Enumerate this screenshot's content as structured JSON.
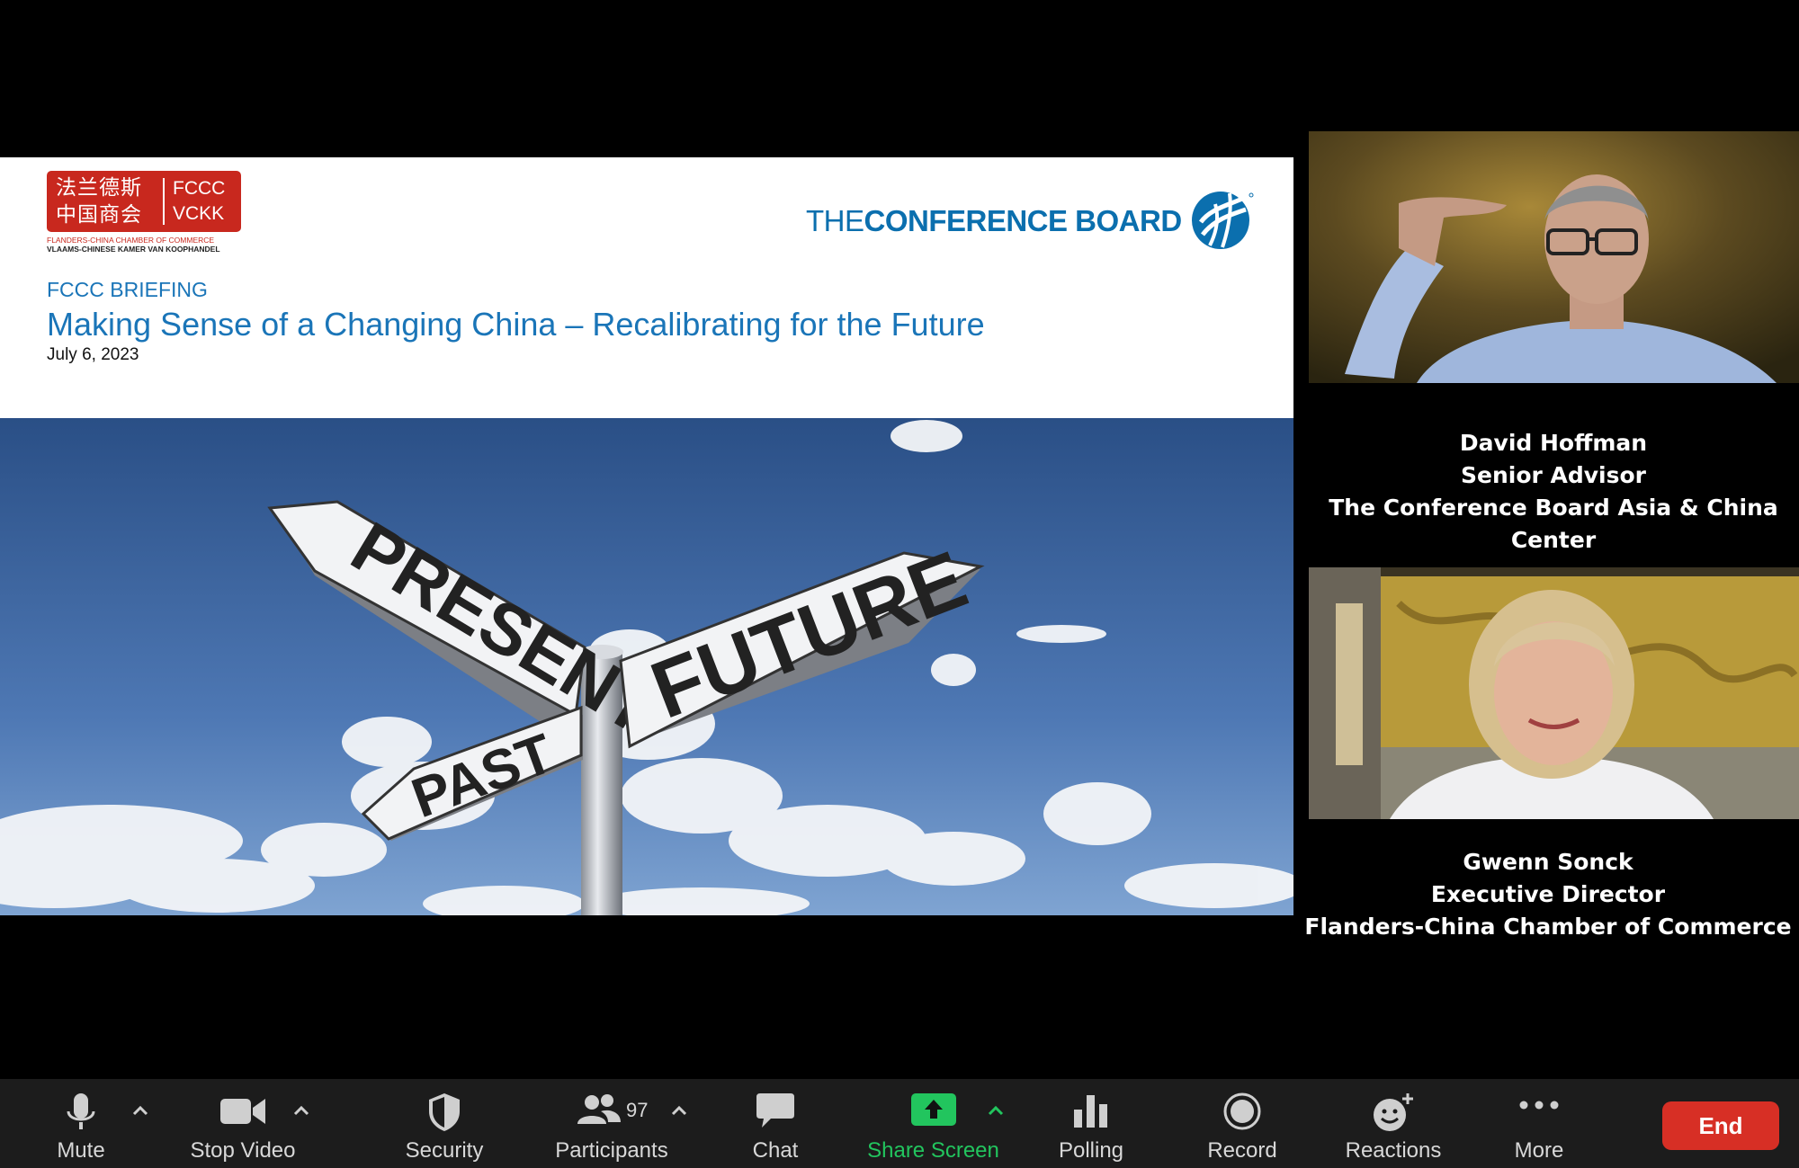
{
  "slide": {
    "logo_chinese_line1": "法兰德斯",
    "logo_chinese_line2": "中国商会",
    "logo_latin_line1": "FCCC",
    "logo_latin_line2": "VCKK",
    "logo_sub_line1": "FLANDERS-CHINA CHAMBER OF COMMERCE",
    "logo_sub_line2": "VLAAMS-CHINESE KAMER VAN KOOPHANDEL",
    "brand_the": "THE",
    "brand_name": "CONFERENCE BOARD",
    "eyebrow": "FCCC BRIEFING",
    "title": "Making Sense of a Changing China – Recalibrating for the Future",
    "date": "July 6, 2023",
    "sign_present": "PRESENT",
    "sign_future": "FUTURE",
    "sign_past": "PAST"
  },
  "participants": [
    {
      "name": "David Hoffman",
      "role": "Senior Advisor",
      "org": "The Conference Board Asia & China Center"
    },
    {
      "name": "Gwenn Sonck",
      "role": "Executive Director",
      "org": "Flanders-China Chamber of Commerce"
    }
  ],
  "toolbar": {
    "mute": "Mute",
    "stop_video": "Stop Video",
    "security": "Security",
    "participants": "Participants",
    "participants_count": "97",
    "chat": "Chat",
    "share_screen": "Share Screen",
    "polling": "Polling",
    "record": "Record",
    "reactions": "Reactions",
    "more": "More",
    "end": "End"
  },
  "colors": {
    "toolbar_bg": "#1c1c1c",
    "share_green": "#22c55e",
    "end_red": "#d72f25",
    "slide_blue": "#1a75b8",
    "fccc_red": "#c8281e"
  },
  "icons": [
    "microphone-icon",
    "video-camera-icon",
    "shield-icon",
    "people-icon",
    "chat-bubble-icon",
    "share-arrow-icon",
    "bar-chart-icon",
    "record-icon",
    "emoji-add-icon",
    "more-dots-icon"
  ]
}
